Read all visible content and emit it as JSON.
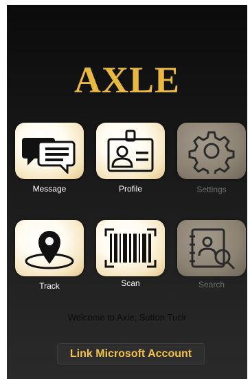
{
  "app": {
    "title": "AXLE"
  },
  "tiles": [
    {
      "label": "Message",
      "icon": "message-icon",
      "enabled": true
    },
    {
      "label": "Profile",
      "icon": "id-badge-icon",
      "enabled": true
    },
    {
      "label": "Settings",
      "icon": "gear-icon",
      "enabled": false
    },
    {
      "label": "Track",
      "icon": "location-pin-icon",
      "enabled": true
    },
    {
      "label": "Scan",
      "icon": "barcode-icon",
      "enabled": true
    },
    {
      "label": "Search",
      "icon": "contact-book-search-icon",
      "enabled": false
    }
  ],
  "welcome_text": "Welcome to Axle, Sutton Tuck",
  "link_button_label": "Link Microsoft Account",
  "colors": {
    "accent": "#e9b840",
    "tile": "#f5e4bc",
    "tile_disabled": "#8b8272",
    "icon": "#111111"
  }
}
